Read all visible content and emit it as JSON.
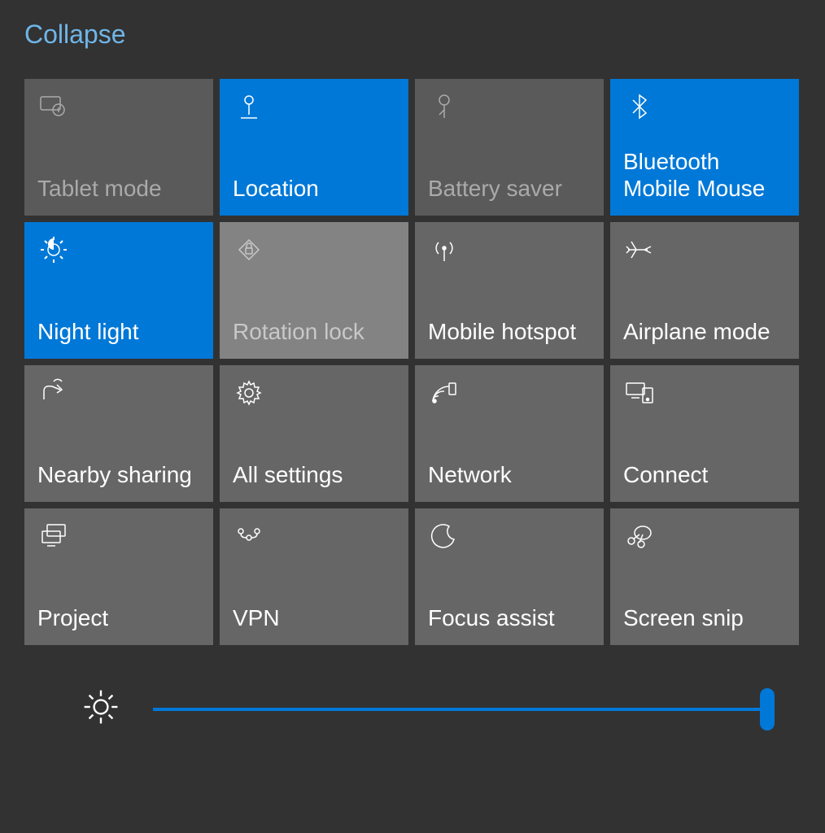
{
  "collapse_label": "Collapse",
  "brightness_percent": 100,
  "tiles": [
    {
      "id": "tablet-mode",
      "label": "Tablet mode",
      "state": "disabled"
    },
    {
      "id": "location",
      "label": "Location",
      "state": "active"
    },
    {
      "id": "battery-saver",
      "label": "Battery saver",
      "state": "disabled"
    },
    {
      "id": "bluetooth",
      "label": "Bluetooth\nMobile Mouse",
      "state": "active"
    },
    {
      "id": "night-light",
      "label": "Night light",
      "state": "active"
    },
    {
      "id": "rotation-lock",
      "label": "Rotation lock",
      "state": "light-disabled"
    },
    {
      "id": "mobile-hotspot",
      "label": "Mobile hotspot",
      "state": "normal"
    },
    {
      "id": "airplane-mode",
      "label": "Airplane mode",
      "state": "normal"
    },
    {
      "id": "nearby-sharing",
      "label": "Nearby sharing",
      "state": "normal"
    },
    {
      "id": "all-settings",
      "label": "All settings",
      "state": "normal"
    },
    {
      "id": "network",
      "label": "Network",
      "state": "normal"
    },
    {
      "id": "connect",
      "label": "Connect",
      "state": "normal"
    },
    {
      "id": "project",
      "label": "Project",
      "state": "normal"
    },
    {
      "id": "vpn",
      "label": "VPN",
      "state": "normal"
    },
    {
      "id": "focus-assist",
      "label": "Focus assist",
      "state": "normal"
    },
    {
      "id": "screen-snip",
      "label": "Screen snip",
      "state": "normal"
    }
  ]
}
